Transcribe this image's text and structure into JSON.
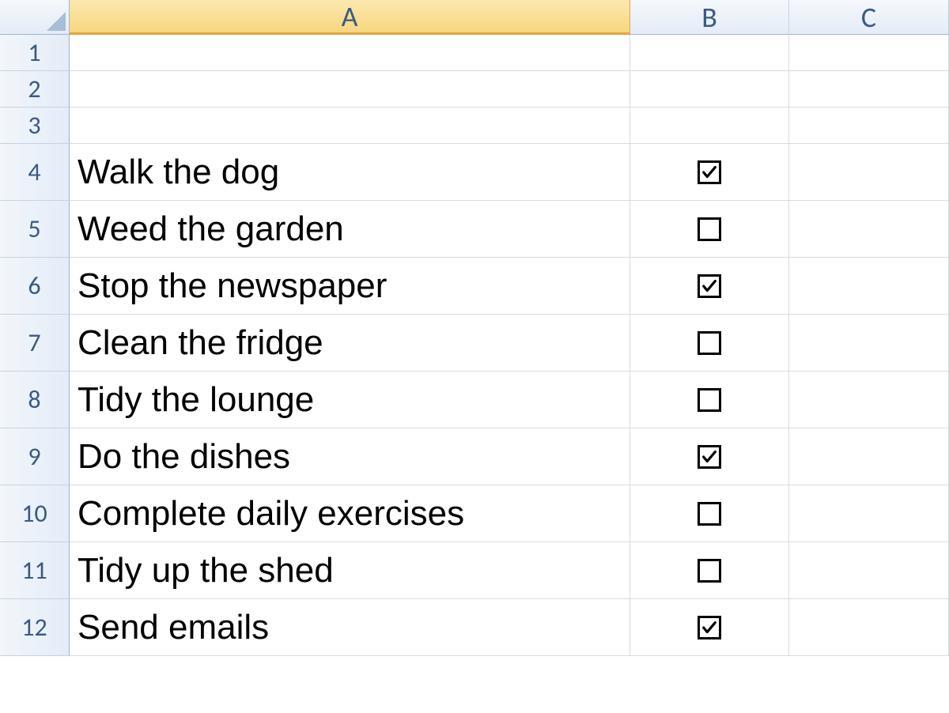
{
  "columns": {
    "a": "A",
    "b": "B",
    "c": "C"
  },
  "rows": [
    {
      "num": "1",
      "task": "",
      "checkbox": null,
      "tall": false
    },
    {
      "num": "2",
      "task": "",
      "checkbox": null,
      "tall": false
    },
    {
      "num": "3",
      "task": "",
      "checkbox": null,
      "tall": false
    },
    {
      "num": "4",
      "task": "Walk the dog",
      "checkbox": true,
      "tall": true
    },
    {
      "num": "5",
      "task": "Weed the garden",
      "checkbox": false,
      "tall": true
    },
    {
      "num": "6",
      "task": "Stop the newspaper",
      "checkbox": true,
      "tall": true
    },
    {
      "num": "7",
      "task": "Clean the fridge",
      "checkbox": false,
      "tall": true
    },
    {
      "num": "8",
      "task": "Tidy the lounge",
      "checkbox": false,
      "tall": true
    },
    {
      "num": "9",
      "task": "Do the dishes",
      "checkbox": true,
      "tall": true
    },
    {
      "num": "10",
      "task": "Complete daily exercises",
      "checkbox": false,
      "tall": true
    },
    {
      "num": "11",
      "task": "Tidy up the shed",
      "checkbox": false,
      "tall": true
    },
    {
      "num": "12",
      "task": "Send emails",
      "checkbox": true,
      "tall": true
    }
  ],
  "selected_column": "A"
}
